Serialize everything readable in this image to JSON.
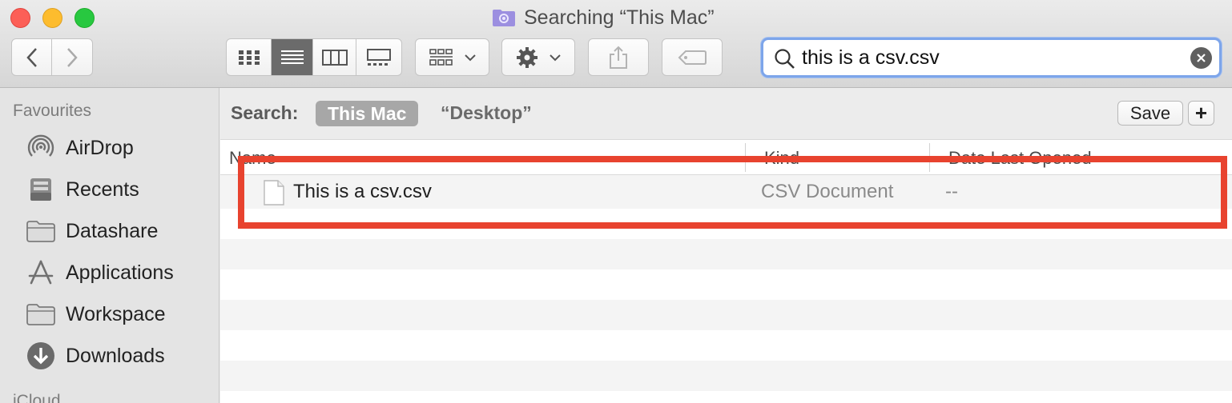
{
  "window": {
    "title": "Searching “This Mac”"
  },
  "toolbar": {
    "back": "back",
    "forward": "forward",
    "views": [
      "icon-view",
      "list-view",
      "column-view",
      "gallery-view"
    ],
    "active_view": "list-view",
    "group_by": "group",
    "action": "action",
    "share": "share",
    "tags": "tags"
  },
  "search": {
    "value": "this is a csv.csv",
    "placeholder": "Search"
  },
  "sidebar": {
    "heading": "Favourites",
    "items": [
      {
        "label": "AirDrop",
        "icon": "airdrop-icon"
      },
      {
        "label": "Recents",
        "icon": "recents-icon"
      },
      {
        "label": "Datashare",
        "icon": "folder-icon"
      },
      {
        "label": "Applications",
        "icon": "applications-icon"
      },
      {
        "label": "Workspace",
        "icon": "folder-icon"
      },
      {
        "label": "Downloads",
        "icon": "downloads-icon"
      }
    ],
    "next_heading": "iCloud"
  },
  "scope": {
    "label": "Search:",
    "active": "This Mac",
    "other": "“Desktop”",
    "save": "Save",
    "add": "+"
  },
  "columns": {
    "name": "Name",
    "kind": "Kind",
    "date": "Date Last Opened"
  },
  "results": [
    {
      "name": "This is a csv.csv",
      "kind": "CSV Document",
      "date": "--"
    }
  ],
  "colors": {
    "highlight": "#e8432f",
    "search_focus": "#7da5ea"
  }
}
